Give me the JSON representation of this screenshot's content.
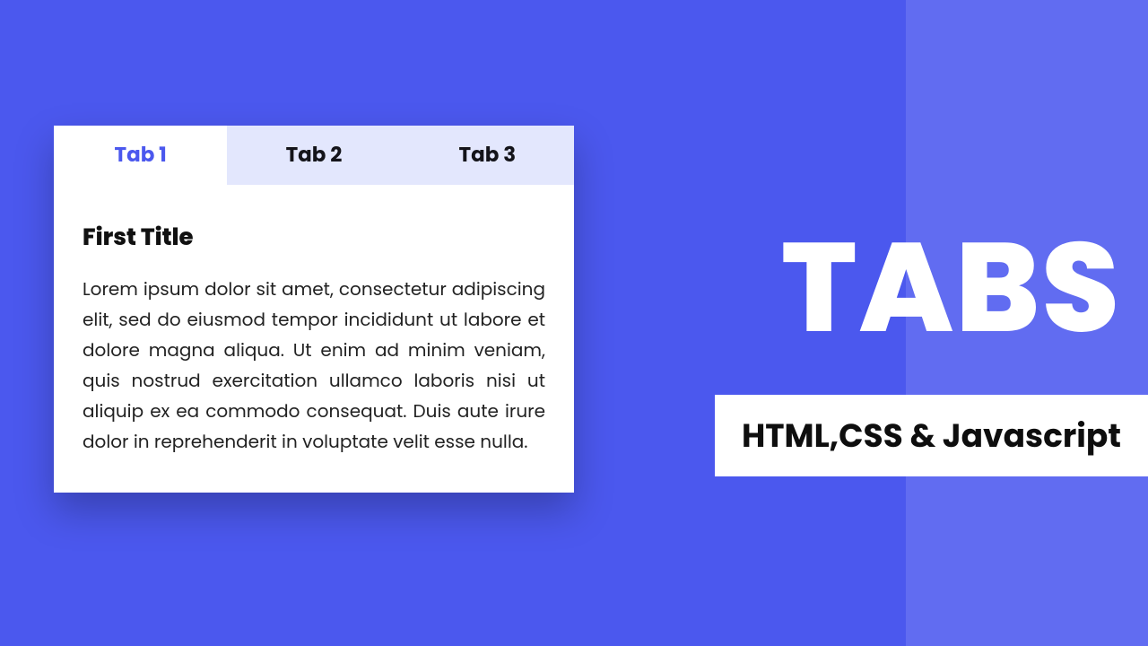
{
  "hero": {
    "title": "TABS",
    "subtitle": "HTML,CSS & Javascript"
  },
  "tabs": [
    {
      "label": "Tab 1",
      "active": true
    },
    {
      "label": "Tab 2",
      "active": false
    },
    {
      "label": "Tab 3",
      "active": false
    }
  ],
  "content": {
    "title": "First Title",
    "body": "Lorem ipsum dolor sit amet, consectetur adipiscing elit, sed do eiusmod tempor incididunt ut labore et dolore magna aliqua. Ut enim ad minim veniam, quis nostrud exercitation ullamco laboris nisi ut aliquip ex ea commodo consequat. Duis aute irure dolor in reprehenderit in voluptate velit esse nulla."
  }
}
